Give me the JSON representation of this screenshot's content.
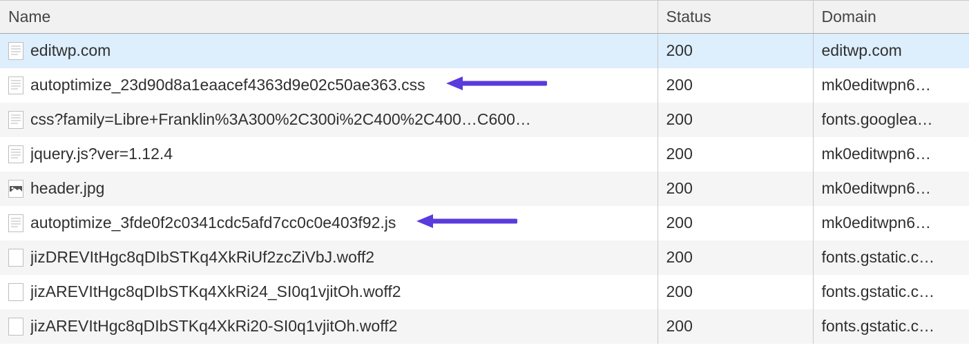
{
  "columns": {
    "name": "Name",
    "status": "Status",
    "domain": "Domain"
  },
  "annotation": {
    "arrow_color": "#5a3bdc"
  },
  "rows": [
    {
      "name": "editwp.com",
      "status": "200",
      "domain": "editwp.com",
      "icon": "document",
      "selected": true,
      "highlighted": false
    },
    {
      "name": "autoptimize_23d90d8a1eaacef4363d9e02c50ae363.css",
      "status": "200",
      "domain": "mk0editwpn6…",
      "icon": "document",
      "selected": false,
      "highlighted": true
    },
    {
      "name": "css?family=Libre+Franklin%3A300%2C300i%2C400%2C400…C600…",
      "status": "200",
      "domain": "fonts.googlea…",
      "icon": "document",
      "selected": false,
      "highlighted": false
    },
    {
      "name": "jquery.js?ver=1.12.4",
      "status": "200",
      "domain": "mk0editwpn6…",
      "icon": "document",
      "selected": false,
      "highlighted": false
    },
    {
      "name": "header.jpg",
      "status": "200",
      "domain": "mk0editwpn6…",
      "icon": "image",
      "selected": false,
      "highlighted": false
    },
    {
      "name": "autoptimize_3fde0f2c0341cdc5afd7cc0c0e403f92.js",
      "status": "200",
      "domain": "mk0editwpn6…",
      "icon": "document",
      "selected": false,
      "highlighted": true
    },
    {
      "name": "jizDREVItHgc8qDIbSTKq4XkRiUf2zcZiVbJ.woff2",
      "status": "200",
      "domain": "fonts.gstatic.c…",
      "icon": "font",
      "selected": false,
      "highlighted": false
    },
    {
      "name": "jizAREVItHgc8qDIbSTKq4XkRi24_SI0q1vjitOh.woff2",
      "status": "200",
      "domain": "fonts.gstatic.c…",
      "icon": "font",
      "selected": false,
      "highlighted": false
    },
    {
      "name": "jizAREVItHgc8qDIbSTKq4XkRi20-SI0q1vjitOh.woff2",
      "status": "200",
      "domain": "fonts.gstatic.c…",
      "icon": "font",
      "selected": false,
      "highlighted": false
    }
  ]
}
